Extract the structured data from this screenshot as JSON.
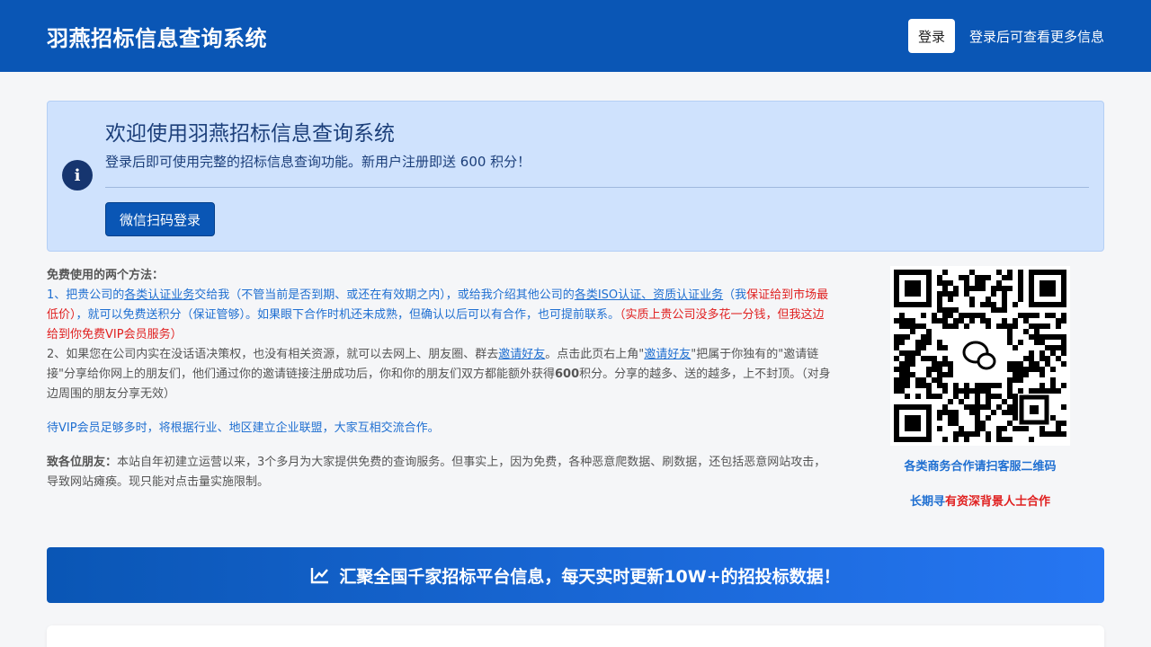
{
  "header": {
    "title": "羽燕招标信息查询系统",
    "login_label": "登录",
    "login_hint": "登录后可查看更多信息"
  },
  "alert": {
    "icon": "info-icon",
    "title": "欢迎使用羽燕招标信息查询系统",
    "subtitle": "登录后即可使用完整的招标信息查询功能。新用户注册即送 600 积分！",
    "wechat_label": "微信扫码登录"
  },
  "methods": {
    "heading": "免费使用的两个方法：",
    "m1_a": "1、把贵公司的",
    "m1_link1": "各类认证业务",
    "m1_b": "交给我（不管当前是否到期、或还在有效期之内），或给我介绍其他公司的",
    "m1_link2": "各类ISO认证、资质认证业务",
    "m1_c": "（我",
    "m1_red1": "保证给到市场最低价）",
    "m1_d": "，就可以免费送积分（保证管够）。如果眼下合作时机还未成熟，但确认以后可以有合作，也可提前联系。",
    "m1_red2": "（实质上贵公司没多花一分钱，但我这边给到你免费VIP会员服务）",
    "m2_a": "2、如果您在公司内实在没话语决策权，也没有相关资源，就可以去网上、朋友圈、群去",
    "m2_link1": "邀请好友",
    "m2_b": "。点击此页右上角\"",
    "m2_link2": "邀请好友",
    "m2_c": "\"把属于你独有的\"邀请链接\"分享给你网上的朋友们，他们通过你的邀请链接注册成功后，你和你的朋友们双方都能额外获得",
    "m2_bold": "600",
    "m2_d": "积分。分享的越多、送的越多，上不封顶。（对身边周围的朋友分享无效）",
    "vip": "待VIP会员足够多时，将根据行业、地区建立企业联盟，大家互相交流合作。",
    "note_bold": "致各位朋友：",
    "note_text": "本站自年初建立运营以来，3个多月为大家提供免费的查询服务。但事实上，因为免费，各种恶意爬数据、刷数据，还包括恶意网站攻击，导致网站瘫痪。现只能对点击量实施限制。"
  },
  "qr": {
    "icon": "wechat-icon",
    "caption": "各类商务合作请扫客服二维码",
    "caption2_a": "长期寻",
    "caption2_b": "有资深背景人士合作"
  },
  "banner": {
    "icon": "chart-line-icon",
    "text": "汇聚全国千家招标平台信息，每天实时更新10W+的招投标数据！"
  },
  "colors": {
    "primary": "#0a56b5",
    "alert_bg": "#cfe2fd",
    "link": "#1f6fd1",
    "red": "#e02020"
  }
}
